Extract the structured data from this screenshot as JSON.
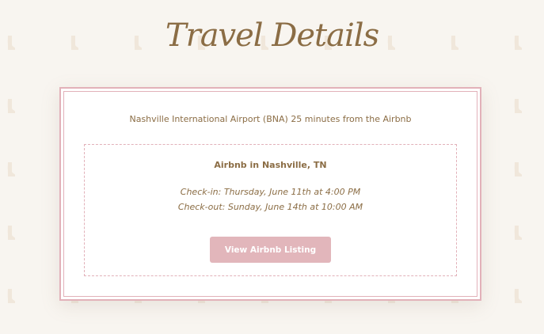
{
  "page": {
    "title": "Travel Details"
  },
  "card": {
    "airport_note": "Nashville International Airport (BNA) 25 minutes from the Airbnb",
    "stay": {
      "title": "Airbnb in Nashville, TN",
      "check_in": "Check-in: Thursday, June 11th at 4:00 PM",
      "check_out": "Check-out: Sunday, June 14th at 10:00 AM",
      "button_label": "View Airbnb Listing"
    }
  },
  "colors": {
    "background": "#f8f5f0",
    "text_brown": "#8b6d45",
    "accent_pink": "#e2b1b9",
    "button_pink": "#e2b6bb",
    "card_white": "#ffffff"
  },
  "icons": {
    "background_pattern": "cowboy-boot-icon"
  }
}
